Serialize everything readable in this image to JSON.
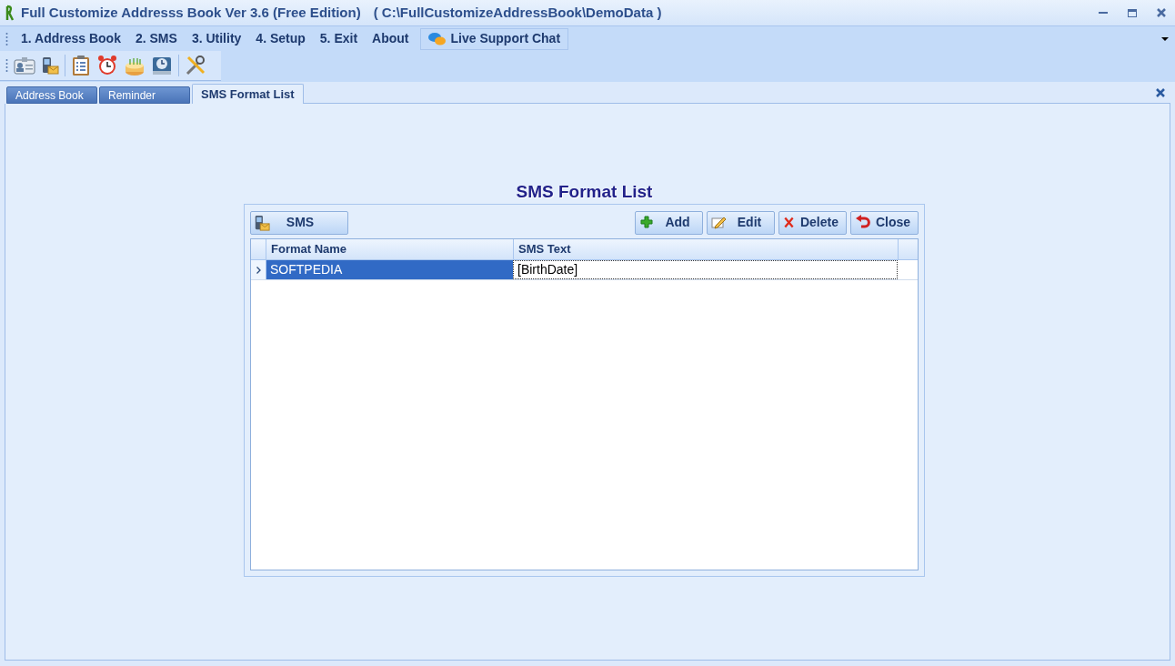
{
  "window": {
    "title": "Full Customize Addresss Book Ver 3.6 (Free Edition)",
    "path": "( C:\\FullCustomizeAddressBook\\DemoData )"
  },
  "menu": [
    {
      "label": "1. Address Book"
    },
    {
      "label": "2. SMS"
    },
    {
      "label": "3. Utility"
    },
    {
      "label": "4. Setup"
    },
    {
      "label": "5. Exit"
    },
    {
      "label": "About"
    }
  ],
  "live_support_chat": "Live Support Chat",
  "tabs": [
    {
      "label": "Address Book",
      "selected": false
    },
    {
      "label": "Reminder",
      "selected": false
    },
    {
      "label": "SMS Format List",
      "selected": true
    }
  ],
  "panel": {
    "title": "SMS Format List",
    "sms_button": "SMS",
    "actions": [
      {
        "kind": "add",
        "label": "Add"
      },
      {
        "kind": "edit",
        "label": "Edit"
      },
      {
        "kind": "delete",
        "label": "Delete"
      },
      {
        "kind": "close",
        "label": "Close"
      }
    ],
    "table": {
      "columns": [
        "Format Name",
        "SMS Text"
      ],
      "rows": [
        {
          "selected": true,
          "cells": [
            "SOFTPEDIA",
            "[BirthDate]"
          ]
        }
      ]
    }
  }
}
